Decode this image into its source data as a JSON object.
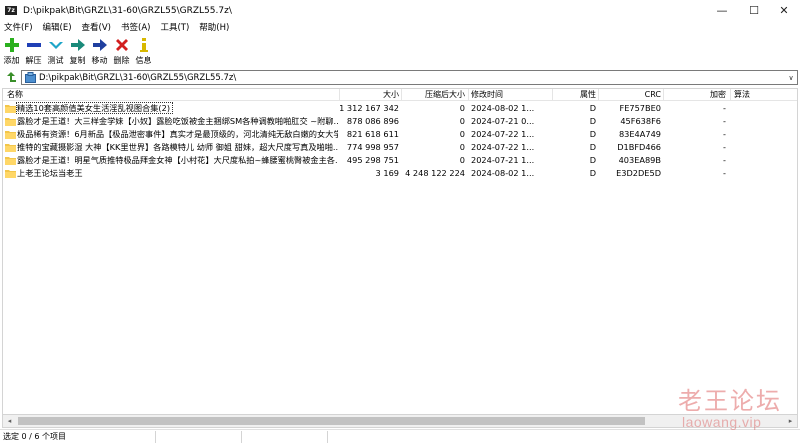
{
  "window": {
    "app_icon_text": "7z",
    "title": "D:\\pikpak\\Bit\\GRZL\\31-60\\GRZL55\\GRZL55.7z\\",
    "minimize_glyph": "—",
    "maximize_glyph": "☐",
    "close_glyph": "✕"
  },
  "menu": [
    {
      "label": "文件(F)"
    },
    {
      "label": "编辑(E)"
    },
    {
      "label": "查看(V)"
    },
    {
      "label": "书签(A)"
    },
    {
      "label": "工具(T)"
    },
    {
      "label": "帮助(H)"
    }
  ],
  "toolbar": [
    {
      "label": "添加",
      "icon": "plus-icon",
      "color": "#2bb01e"
    },
    {
      "label": "解压",
      "icon": "minus-icon",
      "color": "#1f3fb5"
    },
    {
      "label": "测试",
      "icon": "check-icon",
      "color": "#1ea5c8"
    },
    {
      "label": "复制",
      "icon": "copy-arrow-icon",
      "color": "#1a8a7a"
    },
    {
      "label": "移动",
      "icon": "move-arrow-icon",
      "color": "#1f3f9f"
    },
    {
      "label": "删除",
      "icon": "delete-icon",
      "color": "#d21f1f"
    },
    {
      "label": "信息",
      "icon": "info-icon",
      "color": "#d8b800"
    }
  ],
  "address": {
    "path": "D:\\pikpak\\Bit\\GRZL\\31-60\\GRZL55\\GRZL55.7z\\",
    "dropdown_glyph": "∨"
  },
  "columns": {
    "name": "名称",
    "size": "大小",
    "packed": "压缩后大小",
    "mtime": "修改时间",
    "attr": "属性",
    "crc": "CRC",
    "encrypted": "加密",
    "method": "算法"
  },
  "files": [
    {
      "name": "精选10套高颜值美女生活淫乱视图合集(2)",
      "size": "1 312 167 342",
      "packed": "0",
      "mtime": "2024-08-02 1...",
      "attr": "D",
      "crc": "FE757BE0",
      "encrypted": "-",
      "method": "",
      "selected": true
    },
    {
      "name": "露脸才是王道！大三样金学妹【小奴】露脸吃饭被金主捆绑SM各种调教啪啪肛交 ~附聊...",
      "size": "878 086 896",
      "packed": "0",
      "mtime": "2024-07-21 0...",
      "attr": "D",
      "crc": "45F638F6",
      "encrypted": "-",
      "method": "",
      "selected": false
    },
    {
      "name": "极品稀有资源！6月新品【极品泄密事件】真实才是最顶级的，河北清纯无敌白嫩的女大学...",
      "size": "821 618 611",
      "packed": "0",
      "mtime": "2024-07-22 1...",
      "attr": "D",
      "crc": "83E4A749",
      "encrypted": "-",
      "method": "",
      "selected": false
    },
    {
      "name": "推特的宝藏摄影湿 大神【KK里世界】各路模特儿 幼师 御姐 甜妹，超大尺度写真及啪啪...",
      "size": "774 998 957",
      "packed": "0",
      "mtime": "2024-07-22 1...",
      "attr": "D",
      "crc": "D1BFD466",
      "encrypted": "-",
      "method": "",
      "selected": false
    },
    {
      "name": "露脸才是王道！明星气质推特极品拜金女神【小村花】大尺度私拍~蜂腰蜜桃臀被金主各...",
      "size": "495 298 751",
      "packed": "0",
      "mtime": "2024-07-21 1...",
      "attr": "D",
      "crc": "403EA89B",
      "encrypted": "-",
      "method": "",
      "selected": false
    },
    {
      "name": "上老王论坛当老王",
      "size": "3 169",
      "packed": "4 248 122 224",
      "mtime": "2024-08-02 1...",
      "attr": "D",
      "crc": "E3D2DE5D",
      "encrypted": "-",
      "method": "",
      "selected": false
    }
  ],
  "status": {
    "selection": "选定 0 / 6 个项目",
    "cell2": "",
    "cell3": "",
    "cell4": ""
  },
  "watermark": {
    "cn": "老王论坛",
    "en": "laowang.vip"
  },
  "scroll": {
    "left_glyph": "◂",
    "right_glyph": "▸"
  }
}
